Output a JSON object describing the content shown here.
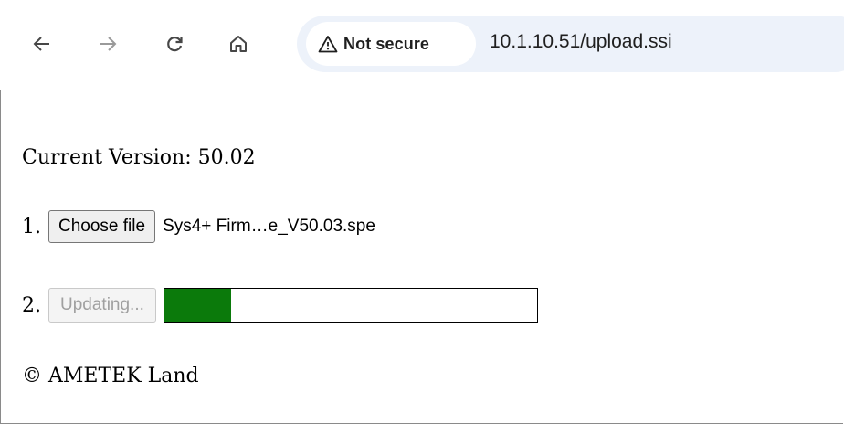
{
  "browser": {
    "security_label": "Not secure",
    "url": "10.1.10.51/upload.ssi",
    "icons": [
      "back-arrow-icon",
      "forward-arrow-icon",
      "reload-icon",
      "home-icon",
      "warning-icon"
    ]
  },
  "page": {
    "current_version_text": "Current Version: 50.02",
    "step1_number": "1.",
    "choose_file_label": "Choose file",
    "file_name": "Sys4+ Firm…e_V50.03.spe",
    "step2_number": "2.",
    "update_button_label": "Updating...",
    "progress_fraction": 0.18,
    "progress_color": "#0b7a0b",
    "copyright_text": "© AMETEK Land"
  }
}
